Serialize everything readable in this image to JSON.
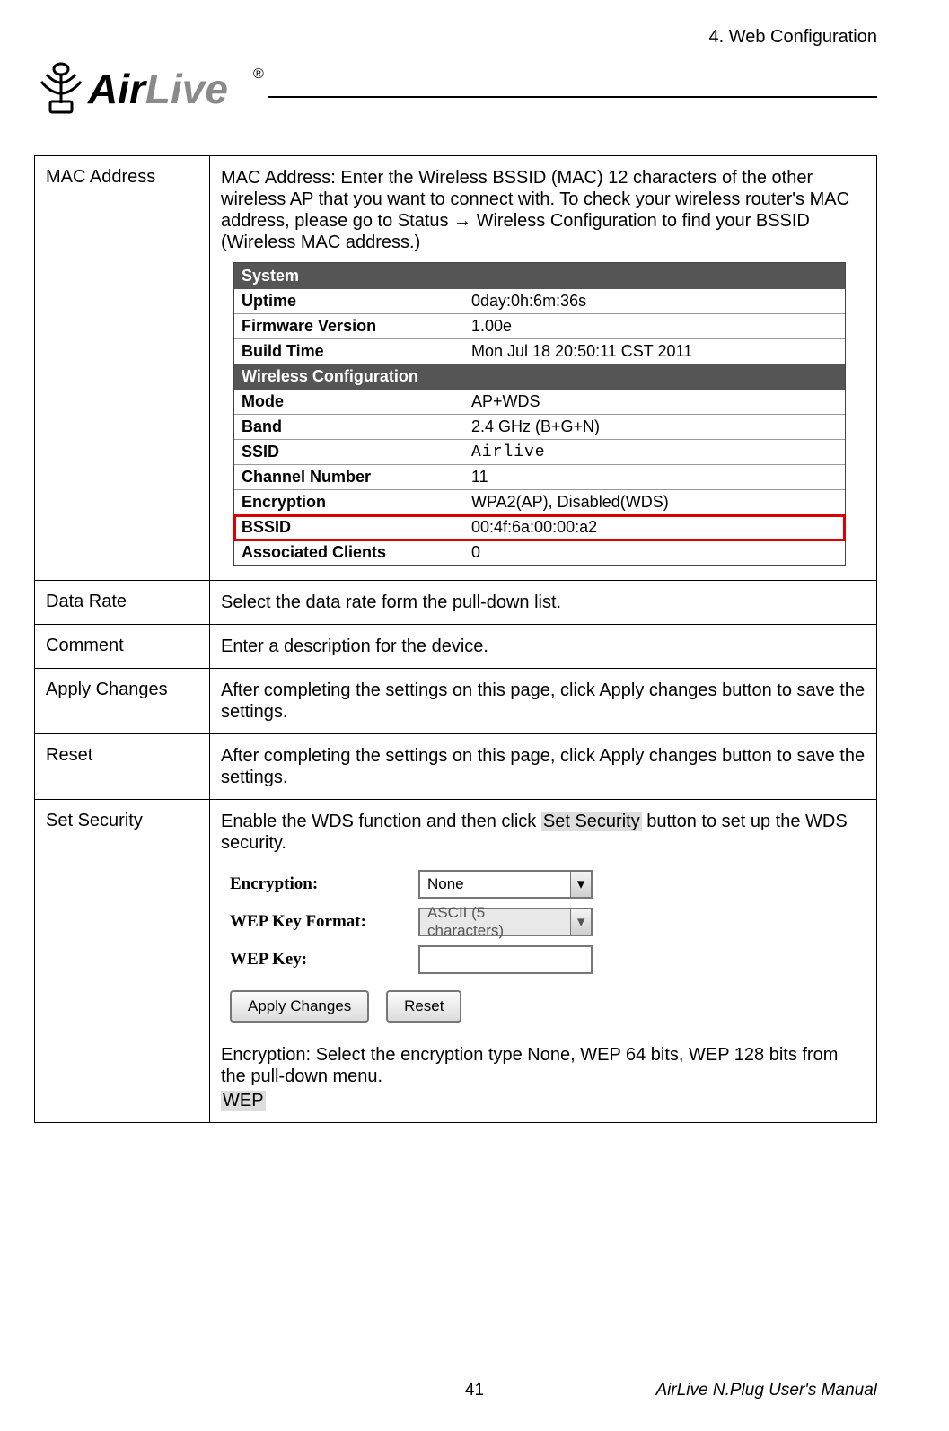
{
  "header": {
    "section": "4. Web Configuration",
    "brand_main": "Air",
    "brand_accent": "Live",
    "brand_reg": "®"
  },
  "rows": {
    "mac": {
      "label": "MAC Address",
      "desc": "MAC Address: Enter the Wireless BSSID (MAC) 12 characters of the other wireless AP that you want to connect with. To check your wireless router's MAC address, please go to Status → Wireless Configuration to find your BSSID (Wireless MAC address.)"
    },
    "data_rate": {
      "label": "Data Rate",
      "desc": "Select the data rate form the pull-down list."
    },
    "comment": {
      "label": "Comment",
      "desc": "Enter a description for the device."
    },
    "apply": {
      "label": "Apply Changes",
      "desc": "After completing the settings on this page, click Apply changes button to save the settings."
    },
    "reset": {
      "label": "Reset",
      "desc": "After completing the settings on this page, click Apply changes button to save the settings."
    },
    "security": {
      "label": "Set Security",
      "desc_pre": "Enable the WDS function and then click ",
      "desc_hl": "Set Security",
      "desc_post": " button to set up the WDS security.",
      "enc_text": "Encryption: Select the encryption type None, WEP 64 bits, WEP 128 bits from the pull-down menu.",
      "wep": "WEP"
    }
  },
  "status": {
    "system_header": "System",
    "uptime_k": "Uptime",
    "uptime_v": "0day:0h:6m:36s",
    "fw_k": "Firmware Version",
    "fw_v": "1.00e",
    "build_k": "Build Time",
    "build_v": "Mon Jul 18 20:50:11 CST 2011",
    "wcfg_header": "Wireless Configuration",
    "mode_k": "Mode",
    "mode_v": "AP+WDS",
    "band_k": "Band",
    "band_v": "2.4 GHz (B+G+N)",
    "ssid_k": "SSID",
    "ssid_v": "Airlive",
    "ch_k": "Channel Number",
    "ch_v": "11",
    "enc_k": "Encryption",
    "enc_v": "WPA2(AP), Disabled(WDS)",
    "bssid_k": "BSSID",
    "bssid_v": "00:4f:6a:00:00:a2",
    "assoc_k": "Associated Clients",
    "assoc_v": "0"
  },
  "form": {
    "encryption_label": "Encryption:",
    "encryption_value": "None",
    "wepfmt_label": "WEP Key Format:",
    "wepfmt_value": "ASCII (5 characters)",
    "wepkey_label": "WEP Key:",
    "apply_btn": "Apply Changes",
    "reset_btn": "Reset"
  },
  "footer": {
    "page": "41",
    "manual": "AirLive N.Plug User's Manual"
  }
}
